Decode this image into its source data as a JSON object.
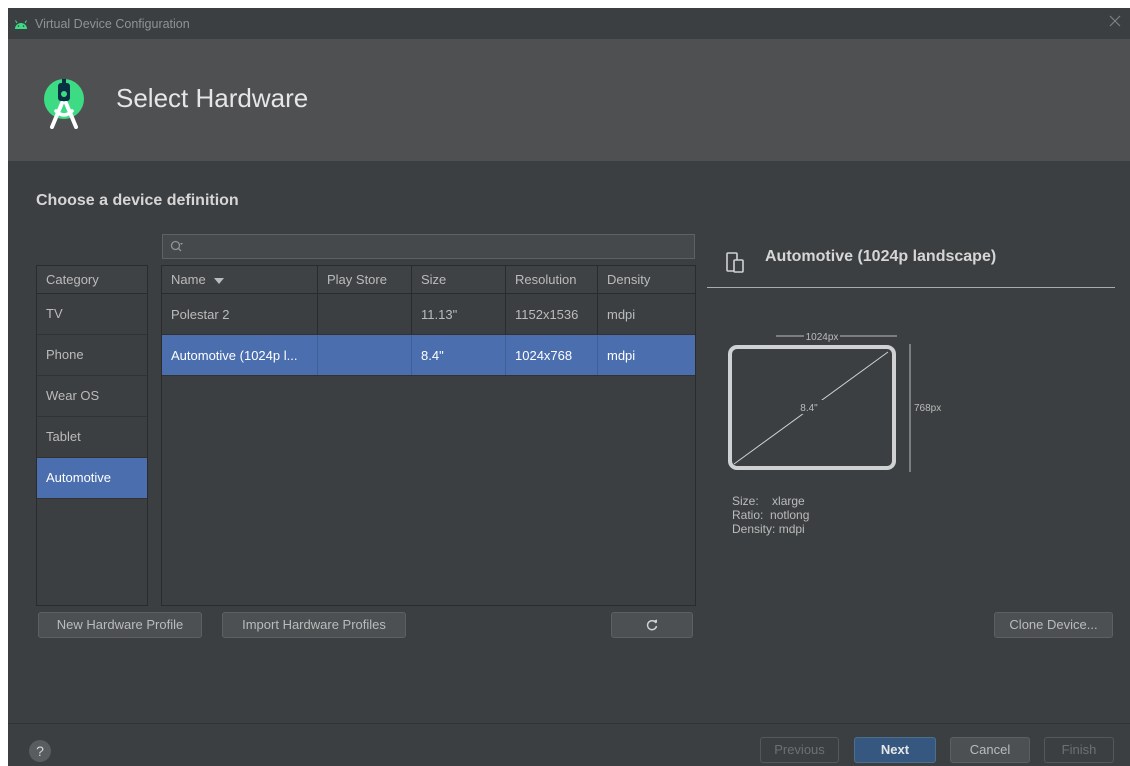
{
  "window": {
    "title": "Virtual Device Configuration"
  },
  "header": {
    "title": "Select Hardware"
  },
  "section_title": "Choose a device definition",
  "search": {
    "value": "",
    "placeholder": ""
  },
  "category": {
    "header": "Category",
    "items": [
      {
        "label": "TV",
        "selected": false
      },
      {
        "label": "Phone",
        "selected": false
      },
      {
        "label": "Wear OS",
        "selected": false
      },
      {
        "label": "Tablet",
        "selected": false
      },
      {
        "label": "Automotive",
        "selected": true
      }
    ]
  },
  "table": {
    "columns": [
      "Name",
      "Play Store",
      "Size",
      "Resolution",
      "Density"
    ],
    "sort_column": "Name",
    "rows": [
      {
        "name": "Polestar 2",
        "play_store": "",
        "size": "11.13\"",
        "resolution": "1152x1536",
        "density": "mdpi",
        "selected": false
      },
      {
        "name": "Automotive (1024p l...",
        "play_store": "",
        "size": "8.4\"",
        "resolution": "1024x768",
        "density": "mdpi",
        "selected": true
      }
    ]
  },
  "buttons": {
    "new_profile": "New Hardware Profile",
    "import_profiles": "Import Hardware Profiles",
    "clone_device": "Clone Device...",
    "previous": "Previous",
    "next": "Next",
    "cancel": "Cancel",
    "finish": "Finish",
    "help": "?"
  },
  "detail": {
    "title": "Automotive (1024p landscape)",
    "width_label": "1024px",
    "height_label": "768px",
    "diagonal_label": "8.4\"",
    "specs": {
      "size_label": "Size:",
      "size_value": "xlarge",
      "ratio_label": "Ratio:",
      "ratio_value": "notlong",
      "density_label": "Density:",
      "density_value": "mdpi"
    }
  },
  "colors": {
    "background": "#3c3f41",
    "header": "#4e5052",
    "selection": "#4b6eaf",
    "primary_button": "#365880",
    "android_green": "#3ddc84"
  },
  "icons": [
    "android-icon",
    "close-icon",
    "android-studio-logo-icon",
    "search-icon",
    "refresh-icon",
    "device-icon",
    "help-icon"
  ]
}
